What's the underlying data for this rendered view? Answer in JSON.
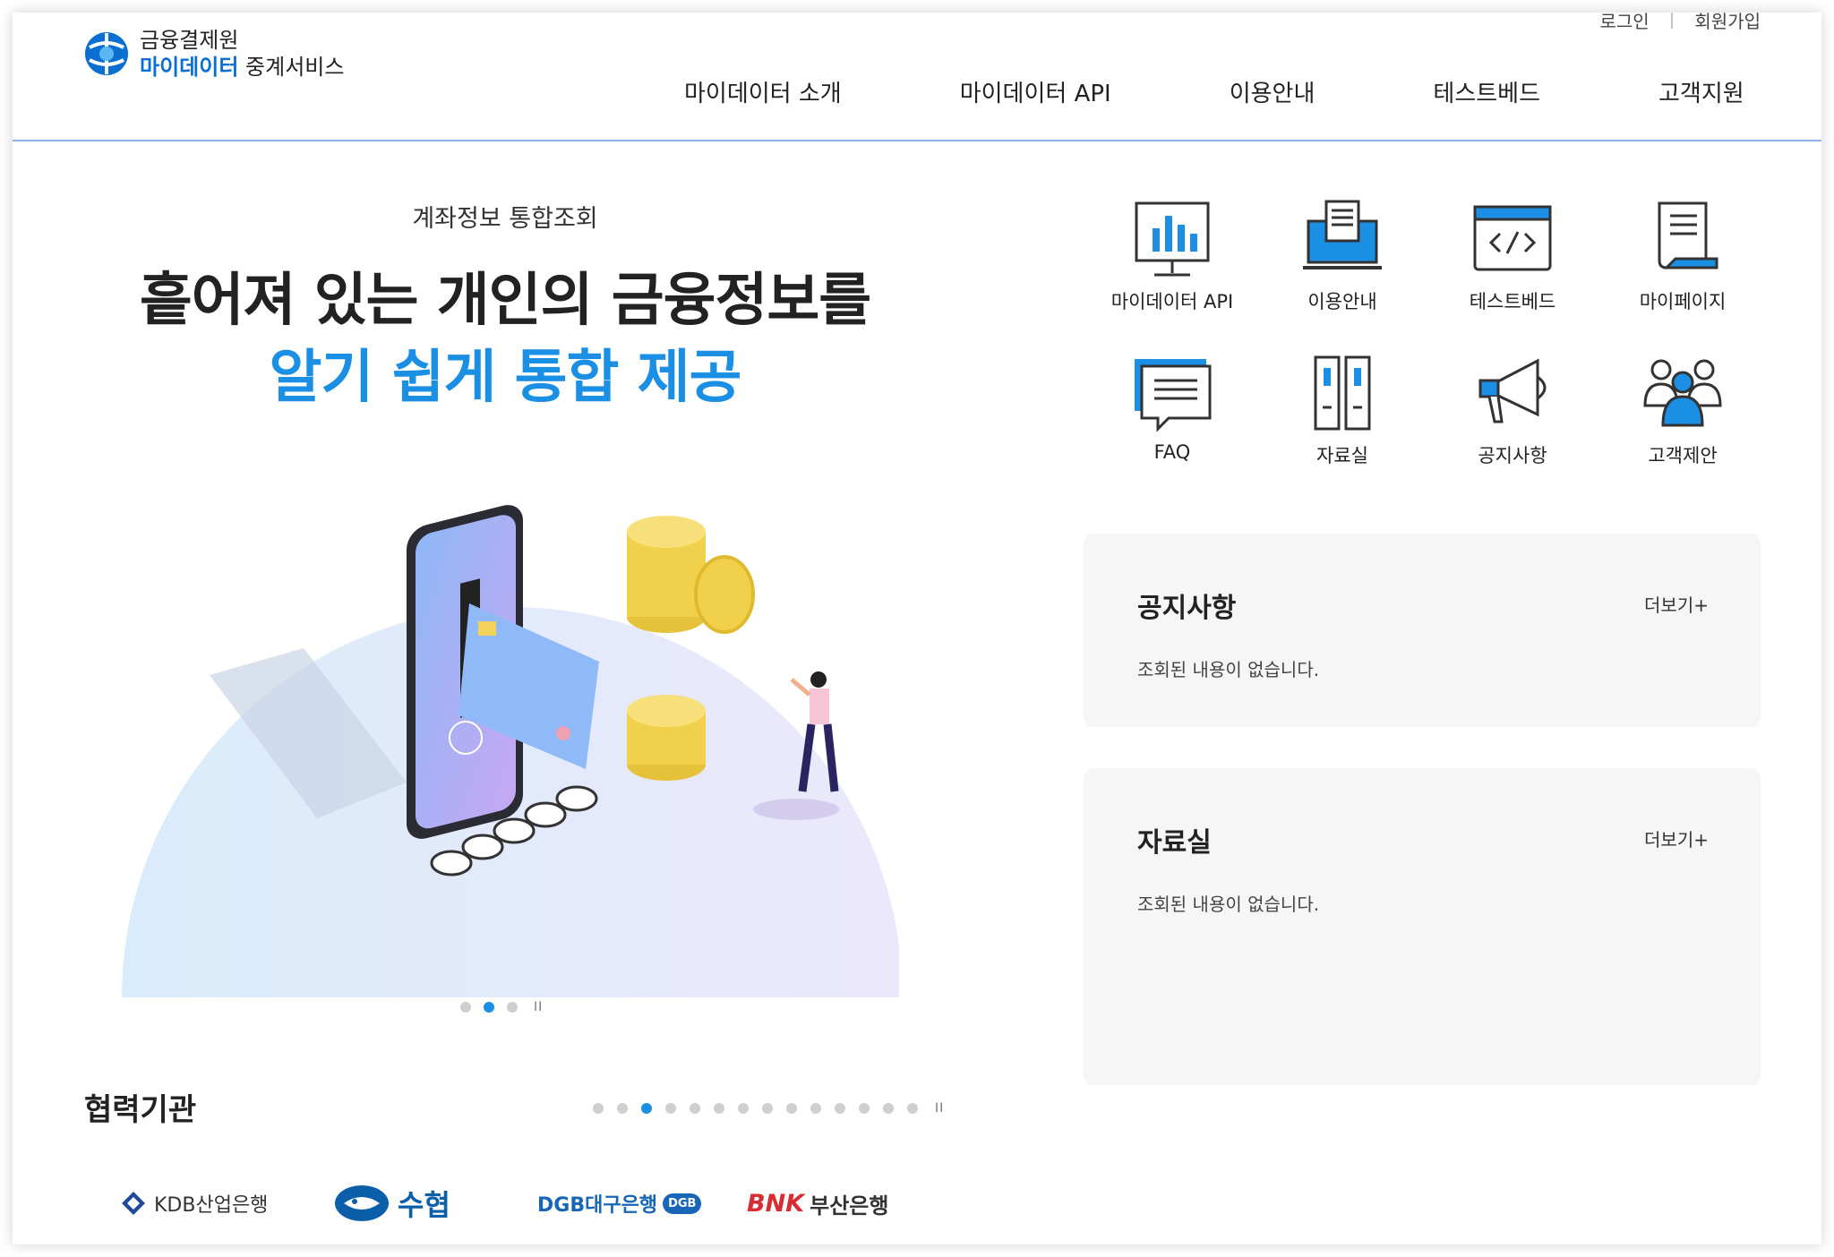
{
  "header": {
    "logo_top": "금융결제원",
    "logo_brand": "마이데이터",
    "logo_rest": "중계서비스",
    "login": "로그인",
    "signup": "회원가입",
    "nav": [
      "마이데이터 소개",
      "마이데이터 API",
      "이용안내",
      "테스트베드",
      "고객지원"
    ]
  },
  "hero": {
    "subtitle": "계좌정보 통합조회",
    "title_line1": "흩어져 있는 개인의 금융정보를",
    "title_line2": "알기 쉽게 통합 제공",
    "slide_count": 3,
    "active_slide": 2,
    "pause": "II"
  },
  "quick_menu": [
    {
      "label": "마이데이터 API",
      "icon": "monitor-chart-icon"
    },
    {
      "label": "이용안내",
      "icon": "laptop-document-icon"
    },
    {
      "label": "테스트베드",
      "icon": "code-window-icon"
    },
    {
      "label": "마이페이지",
      "icon": "document-scroll-icon"
    },
    {
      "label": "FAQ",
      "icon": "chat-bubble-icon"
    },
    {
      "label": "자료실",
      "icon": "binders-icon"
    },
    {
      "label": "공지사항",
      "icon": "megaphone-icon"
    },
    {
      "label": "고객제안",
      "icon": "people-group-icon"
    }
  ],
  "boards": {
    "notice": {
      "title": "공지사항",
      "more": "더보기+",
      "empty": "조회된 내용이 없습니다."
    },
    "archive": {
      "title": "자료실",
      "more": "더보기+",
      "empty": "조회된 내용이 없습니다."
    }
  },
  "partners": {
    "title": "협력기관",
    "dot_count": 14,
    "active_dot": 3,
    "pause": "II",
    "logos": {
      "kdb": "KDB산업은행",
      "nh": "수협",
      "dgb": "DGB대구은행",
      "dgb_badge": "DGB",
      "bnk_mark": "BNK",
      "bnk_name": "부산은행"
    }
  },
  "colors": {
    "accent": "#1a8fe3",
    "brand": "#0a6fd1",
    "panel": "#f6f6f6"
  }
}
